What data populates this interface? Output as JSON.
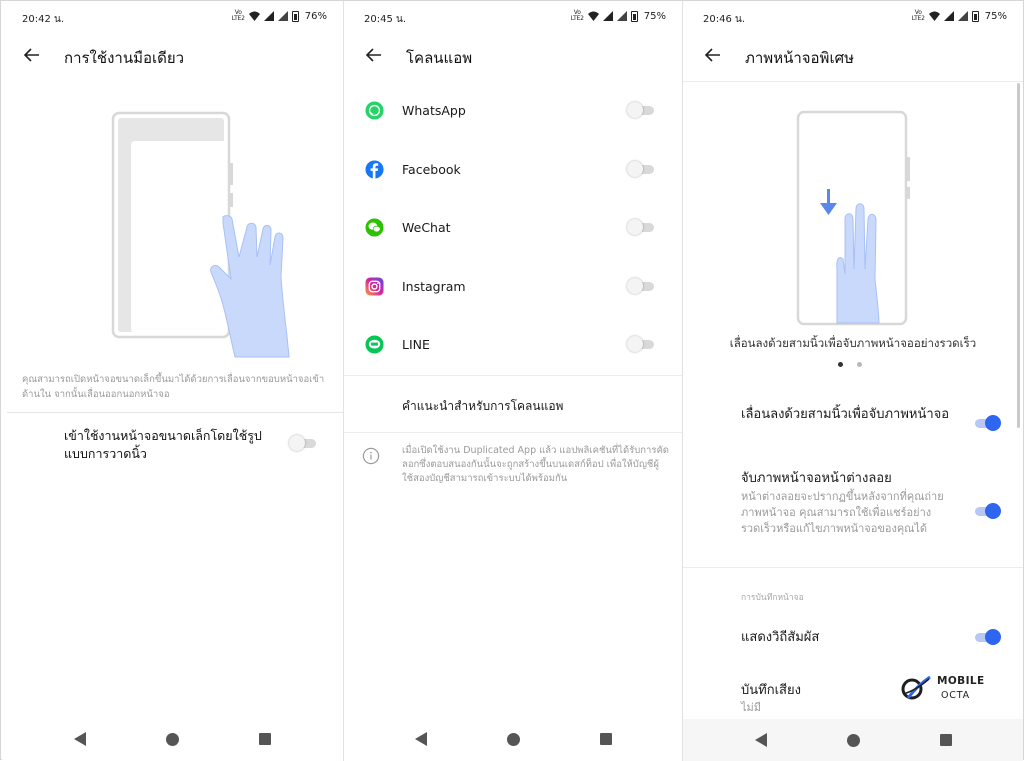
{
  "panels": [
    {
      "status": {
        "time": "20:42 น.",
        "battery": "76%",
        "network": "VoLTE LTE2"
      },
      "title": "การใช้งานมือเดียว",
      "description": "คุณสามารถเปิดหน้าจอขนาดเล็กขึ้นมาได้ด้วยการเลื่อนจากขอบหน้าจอเข้าด้านใน จากนั้นเลื่อนออกนอกหน้าจอ",
      "setting": {
        "label": "เข้าใช้งานหน้าจอขนาดเล็กโดยใช้รูปแบบการวาดนิ้ว",
        "enabled": false
      }
    },
    {
      "status": {
        "time": "20:45 น.",
        "battery": "75%",
        "network": "VoLTE LTE2"
      },
      "title": "โคลนแอพ",
      "apps": [
        {
          "name": "WhatsApp",
          "icon": "whatsapp-icon",
          "color": "#25d366",
          "enabled": false
        },
        {
          "name": "Facebook",
          "icon": "facebook-icon",
          "color": "#1877f2",
          "enabled": false
        },
        {
          "name": "WeChat",
          "icon": "wechat-icon",
          "color": "#2dc100",
          "enabled": false
        },
        {
          "name": "Instagram",
          "icon": "instagram-icon",
          "color": "#d6249f",
          "enabled": false
        },
        {
          "name": "LINE",
          "icon": "line-icon",
          "color": "#06c755",
          "enabled": false
        }
      ],
      "recommendation": "คำแนะนำสำหรับการโคลนแอพ",
      "note": "เมื่อเปิดใช้งาน Duplicated App แล้ว แอปพลิเคชันที่ได้รับการคัดลอกซึ่งตอบสนองกันนั้นจะถูกสร้างขึ้นบนเดสก์ท็อป เพื่อให้บัญชีผู้ใช้สองบัญชีสามารถเข้าระบบได้พร้อมกัน"
    },
    {
      "status": {
        "time": "20:46 น.",
        "battery": "75%",
        "network": "VoLTE LTE2"
      },
      "title": "ภาพหน้าจอพิเศษ",
      "caption": "เลื่อนลงด้วยสามนิ้วเพื่อจับภาพหน้าจออย่างรวดเร็ว",
      "page_indicator": {
        "count": 2,
        "active": 0
      },
      "settings": [
        {
          "title": "เลื่อนลงด้วยสามนิ้วเพื่อจับภาพหน้าจอ",
          "description": "",
          "enabled": true
        },
        {
          "title": "จับภาพหน้าจอหน้าต่างลอย",
          "description": "หน้าต่างลอยจะปรากฏขึ้นหลังจากที่คุณถ่ายภาพหน้าจอ คุณสามารถใช้เพื่อแชร์อย่างรวดเร็วหรือแก้ไขภาพหน้าจอของคุณได้",
          "enabled": true
        }
      ],
      "section_header": "การบันทึกหน้าจอ",
      "record_settings": [
        {
          "title": "แสดงวิถีสัมผัส",
          "enabled": true
        },
        {
          "title": "บันทึกเสียง",
          "value": "ไม่มี"
        }
      ]
    }
  ],
  "watermark": {
    "line1": "MOBILE",
    "line2": "OCTA"
  },
  "colors": {
    "accent": "#2f66f0",
    "illustration": "#c9d9fb",
    "phone_outline": "#d8d8d8"
  }
}
